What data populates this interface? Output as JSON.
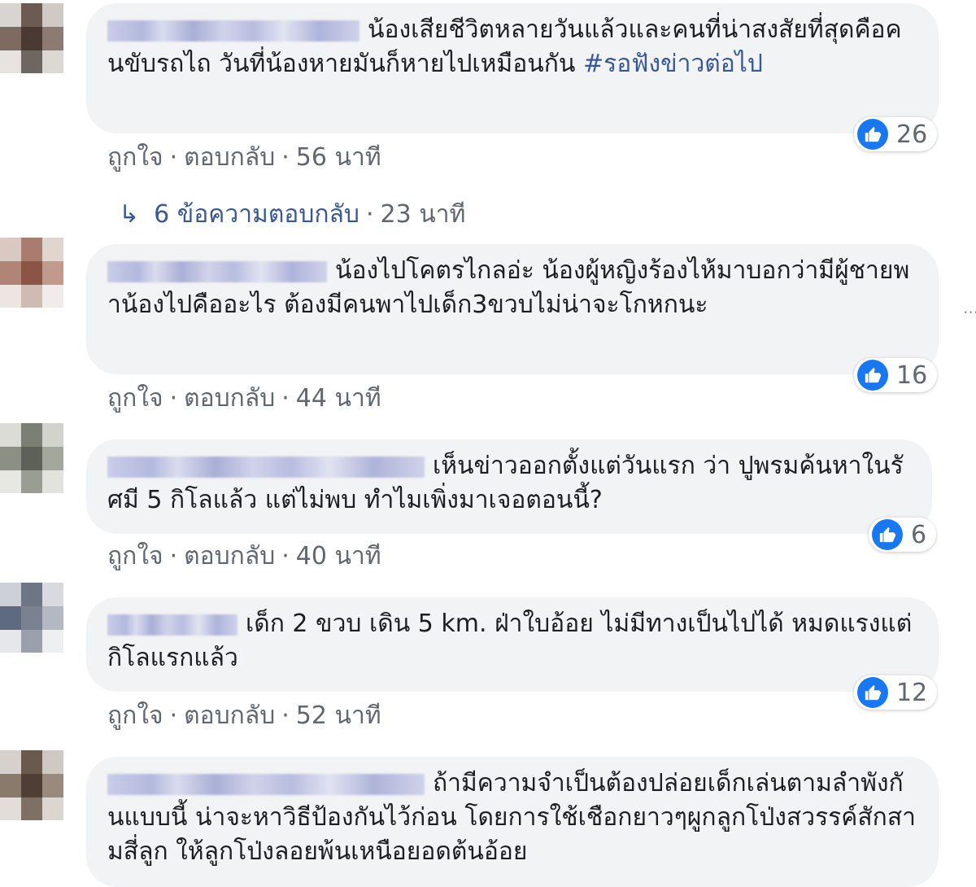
{
  "actions": {
    "like": "ถูกใจ",
    "reply": "ตอบกลับ",
    "separator": "·"
  },
  "comments": [
    {
      "text": "น้องเสียชีวิตหลายวันแล้วและคนที่น่าสงสัยที่สุดคือคนขับรถไถ วันที่น้องหายมันก็หายไปเหมือนกัน ",
      "hashtag": "#รอฟังข่าวต่อไป",
      "likes": "26",
      "time": "56 นาที"
    },
    {
      "text": "น้องไปโคตรไกลอ่ะ น้องผู้หญิงร้องไห้มาบอกว่ามีผู้ชายพาน้องไปคืออะไร ต้องมีคนพาไปเด็ก3ขวบไม่น่าจะโกหกนะ",
      "likes": "16",
      "time": "44 นาที"
    },
    {
      "text": "เห็นข่าวออกตั้งแต่วันแรก ว่า ปูพรมค้นหาในรัศมี 5 กิโลแล้ว แต่ไม่พบ ทำไมเพิ่งมาเจอตอนนี้?",
      "likes": "6",
      "time": "40 นาที"
    },
    {
      "text": "เด็ก 2 ขวบ เดิน 5 km. ฝ่าใบอ้อย ไม่มีทางเป็นไปได้ หมดแรงแต่กิโลแรกแล้ว",
      "likes": "12",
      "time": "52 นาที"
    },
    {
      "text": "ถ้ามีความจำเป็นต้องปล่อยเด็กเล่นตามลำพังกันแบบนี้ น่าจะหาวิธีป้องกันไว้ก่อน โดยการใช้เชือกยาวๆผูกลูกโป่งสวรรค์สักสามสี่ลูก ให้ลูกโป่งลอยพ้นเหนือยอดต้นอ้อย"
    }
  ],
  "replies": {
    "arrow": "↳",
    "label": "6 ข้อความตอบกลับ",
    "time": "23 นาที"
  },
  "more": "···",
  "colors": {
    "like_blue": "#1877f2",
    "bubble_bg": "#f2f3f5",
    "link": "#385898",
    "meta": "#606770"
  }
}
